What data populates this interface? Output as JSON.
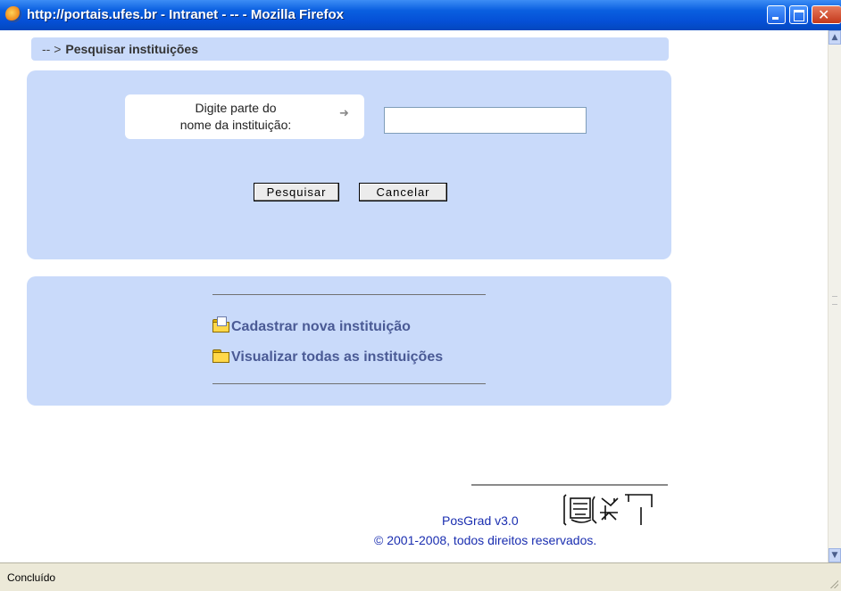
{
  "window": {
    "title": "http://portais.ufes.br - Intranet - -- - Mozilla Firefox",
    "icon": "firefox-icon"
  },
  "breadcrumb": {
    "prefix": "-- >",
    "title": "Pesquisar instituições"
  },
  "search": {
    "label_line1": "Digite parte do",
    "label_line2": "nome da instituição:",
    "arrow": "➜",
    "input_value": "",
    "search_button": "Pesquisar",
    "cancel_button": "Cancelar"
  },
  "links": {
    "new_institution": "Cadastrar nova instituição",
    "view_all": "Visualizar todas as instituições"
  },
  "footer": {
    "version": "PosGrad v3.0",
    "copyright": "© 2001-2008, todos direitos reservados."
  },
  "status": {
    "text": "Concluído"
  },
  "colors": {
    "panel": "#c9dafa",
    "link": "#4a5a95",
    "footer_text": "#1a2eb0",
    "titlebar": "#0550d6"
  }
}
